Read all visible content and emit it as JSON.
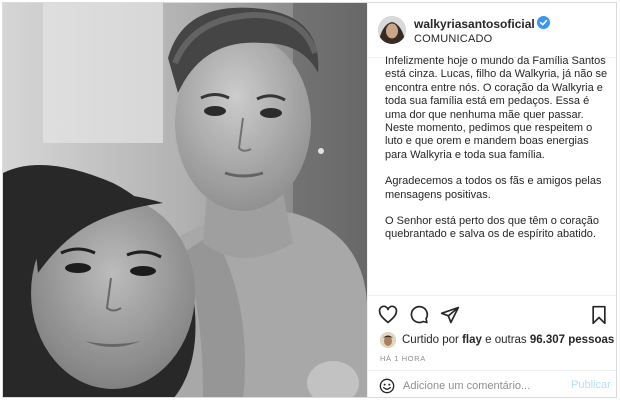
{
  "post": {
    "username": "walkyriasantosoficial",
    "subtitle": "COMUNICADO",
    "caption": [
      "Infelizmente hoje o mundo da Família Santos está cinza. Lucas, filho da Walkyria, já não se encontra entre nós. O coração da Walkyria e toda sua família está em pedaços. Essa é uma dor que nenhuma mãe quer passar. Neste momento, pedimos que respeitem o luto e que orem e mandem boas energias para Walkyria e toda sua família.",
      "Agradecemos a todos os fãs e amigos pelas mensagens positivas.",
      "O Senhor está perto dos que têm o coração quebrantado e salva os de espírito abatido."
    ],
    "likes": {
      "prefix": "Curtido por",
      "user": "flay",
      "middle": "e outras",
      "count": "96.307 pessoas"
    },
    "time_ago": "HÁ 1 HORA",
    "comment": {
      "placeholder": "Adicione um comentário...",
      "publish_label": "Publicar"
    },
    "icons": {
      "like": "heart-icon",
      "comment": "comment-icon",
      "share": "share-icon",
      "save": "bookmark-icon",
      "verified": "verified-badge-icon",
      "emoji": "emoji-icon"
    },
    "colors": {
      "verified": "#3897f0",
      "publish_disabled": "#b2dffc",
      "muted": "#8e8e8e"
    }
  }
}
